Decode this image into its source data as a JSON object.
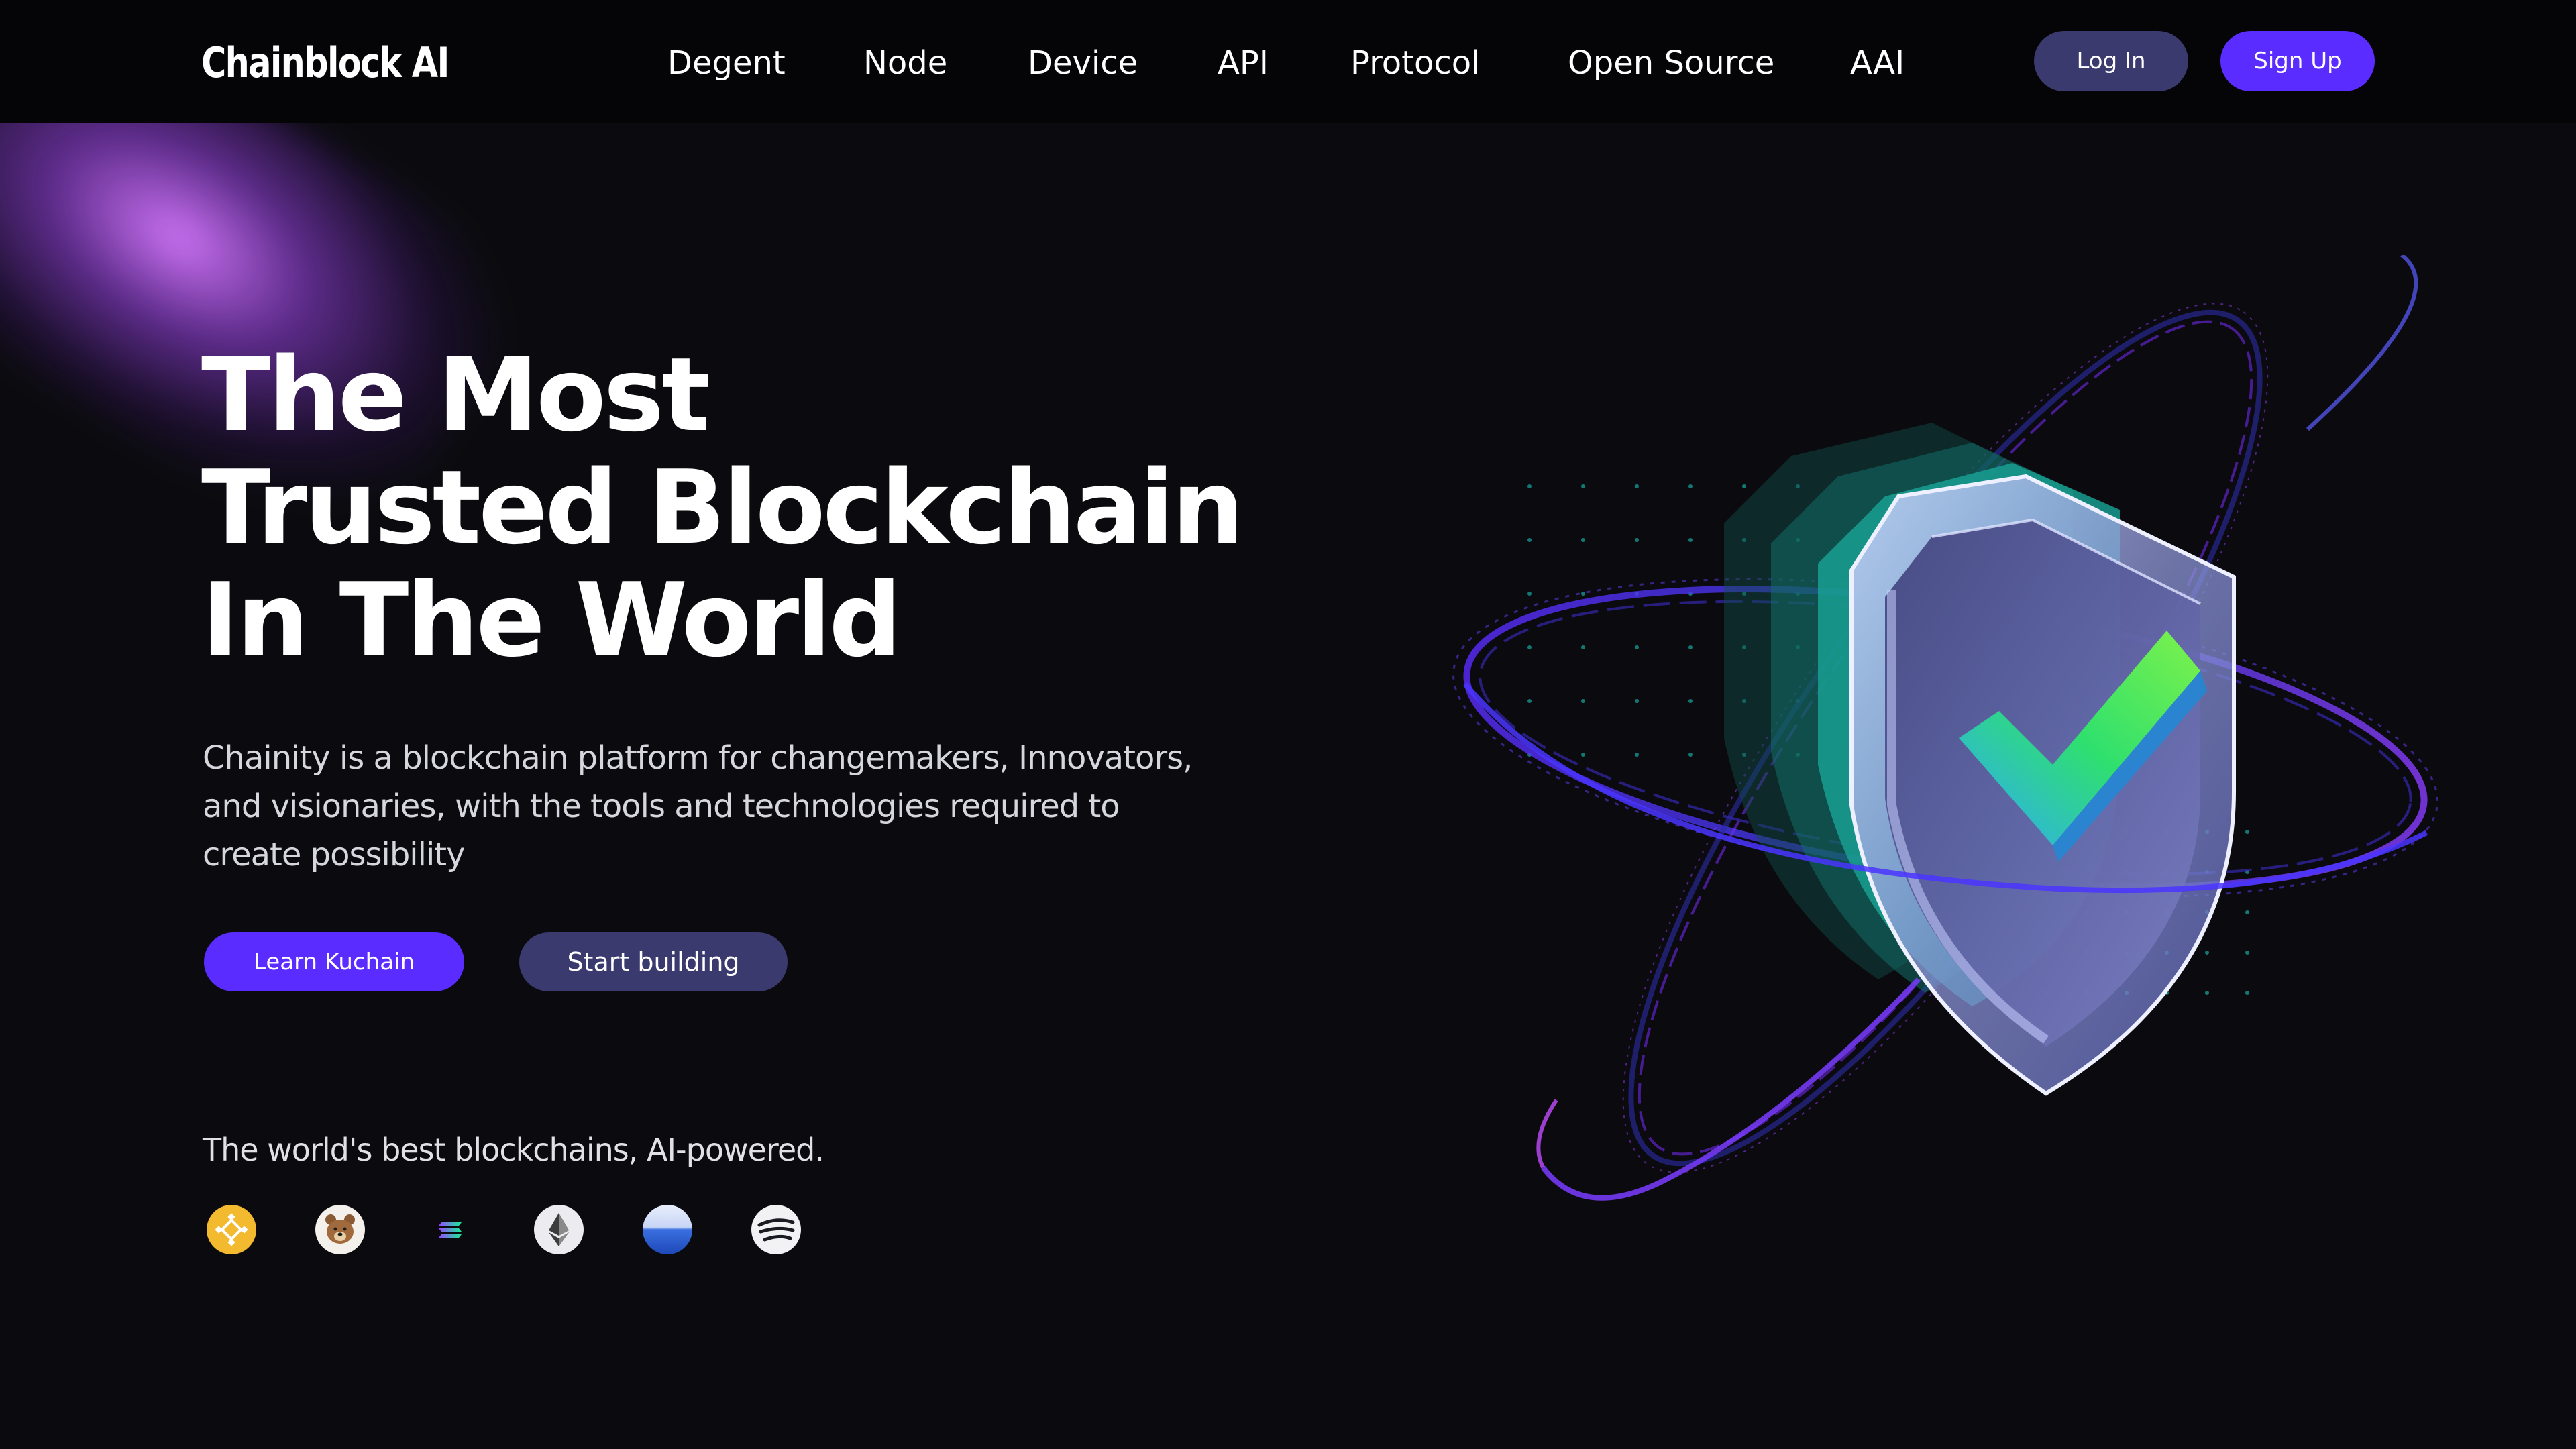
{
  "brand": "Chainblock AI",
  "nav": {
    "items": [
      "Degent",
      "Node",
      "Device",
      "API",
      "Protocol",
      "Open Source",
      "AAI"
    ]
  },
  "auth": {
    "login": "Log In",
    "signup": "Sign Up"
  },
  "hero": {
    "headline": [
      "The Most",
      "Trusted Blockchain",
      "In The World"
    ],
    "description": "Chainity is a blockchain platform for changemakers, Innovators, and visionaries, with the tools and technologies required to create possibility",
    "primary_cta": "Learn Kuchain",
    "secondary_cta": "Start building"
  },
  "chains": {
    "label": "The world's best blockchains, AI-powered.",
    "icons": [
      "bnb-icon",
      "bear-icon",
      "solana-icon",
      "ethereum-icon",
      "sphere-icon",
      "swirl-icon"
    ]
  },
  "colors": {
    "background": "#0b0b0f",
    "accent": "#5b2cff",
    "secondary_button": "#3a3a6e",
    "glow": "#c86bff",
    "shield_teal": "#23c8b0",
    "check_green": "#3ee07a"
  }
}
